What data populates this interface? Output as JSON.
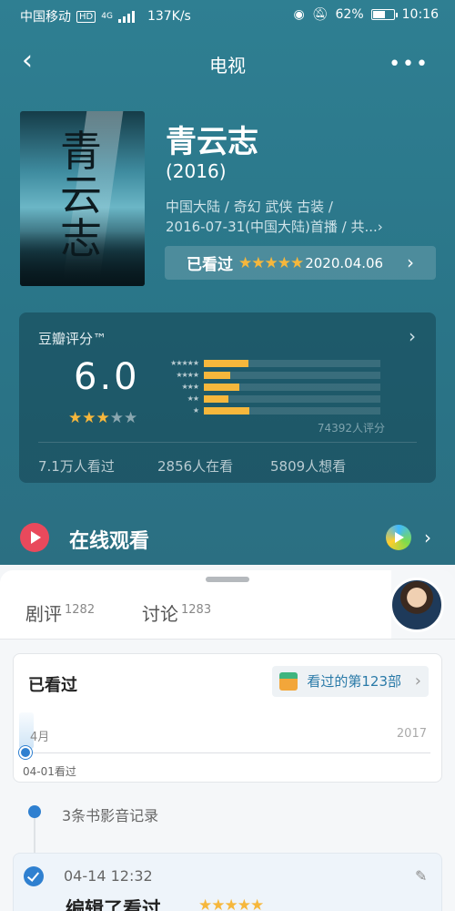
{
  "status_bar": {
    "carrier": "中国移动",
    "hd": "HD",
    "network": "4G",
    "speed": "137K/s",
    "battery": "62%",
    "battery_level": 0.62,
    "time": "10:16"
  },
  "header": {
    "title": "电视",
    "more": "•••"
  },
  "movie": {
    "name": "青云志",
    "year": "(2016)",
    "meta_line1": "中国大陆 / 奇幻 武侠 古装 /",
    "meta_line2": "2016-07-31(中国大陆)首播 / 共...›",
    "poster_text": "青云志"
  },
  "watched_bar": {
    "label": "已看过",
    "stars": "★★★★★",
    "date": "2020.04.06"
  },
  "rating": {
    "label": "豆瓣评分™",
    "score": "6.0",
    "stars_filled": 3,
    "stars_total": 5,
    "distribution": [
      {
        "stars": "★★★★★",
        "value": 0.25
      },
      {
        "stars": "★★★★",
        "value": 0.15
      },
      {
        "stars": "★★★",
        "value": 0.2
      },
      {
        "stars": "★★",
        "value": 0.14
      },
      {
        "stars": "★",
        "value": 0.26
      }
    ],
    "count": "74392人评分",
    "stats": [
      "7.1万人看过",
      "2856人在看",
      "5809人想看"
    ]
  },
  "online": {
    "label": "在线观看"
  },
  "sheet": {
    "tabs": [
      {
        "label": "剧评",
        "count": "1282"
      },
      {
        "label": "讨论",
        "count": "1283"
      }
    ],
    "watched_card": {
      "title": "已看过",
      "tag": "看过的第123部",
      "month": "4月",
      "year": "2017",
      "date": "04-01看过"
    },
    "records": "3条书影音记录",
    "entry": {
      "time": "04-14 12:32",
      "action": "编辑了看过",
      "stars": "★★★★★"
    }
  },
  "colors": {
    "accent_star": "#f6b73c",
    "play_red": "#e9495c",
    "link_blue": "#2f80d0"
  }
}
